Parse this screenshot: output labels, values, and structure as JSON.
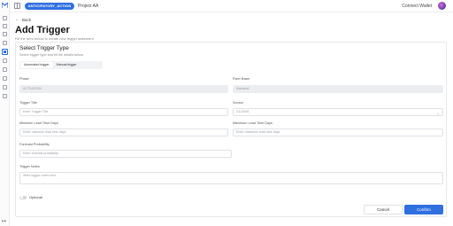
{
  "topbar": {
    "pill": "ANTICIPATORY_ACTION",
    "project": "Project AA",
    "connect": "Connect Wallet"
  },
  "header": {
    "back": "Back",
    "title": "Add Trigger",
    "subtitle": "Fill the form below to create new trigger statement"
  },
  "form": {
    "section_title": "Select Trigger Type",
    "section_subtitle": "Select trigger type and fill the details below",
    "tabs": [
      "Automated trigger",
      "Manual trigger"
    ],
    "phase_label": "Phase",
    "phase_value": "ACTIVATION",
    "river_label": "River Basin",
    "river_value": "Mahakali",
    "trigger_title_label": "Trigger Title",
    "trigger_title_placeholder": "Enter Trigger Title",
    "source_label": "Source",
    "source_value": "GLOFAS",
    "min_lead_label": "Minimum Lead Time Days",
    "min_lead_placeholder": "Enter minimum lead time days",
    "max_lead_label": "Maximum Lead Time Days",
    "max_lead_placeholder": "Enter maximum lead time days",
    "prob_label": "Forecast Probability",
    "prob_placeholder": "Enter forecast probability",
    "notes_label": "Trigger Notes",
    "notes_placeholder": "Write trigger notes here",
    "optional_label": "Optional",
    "cancel": "Cancel",
    "confirm": "Confirm"
  },
  "colors": {
    "accent": "#2f6fe0"
  }
}
